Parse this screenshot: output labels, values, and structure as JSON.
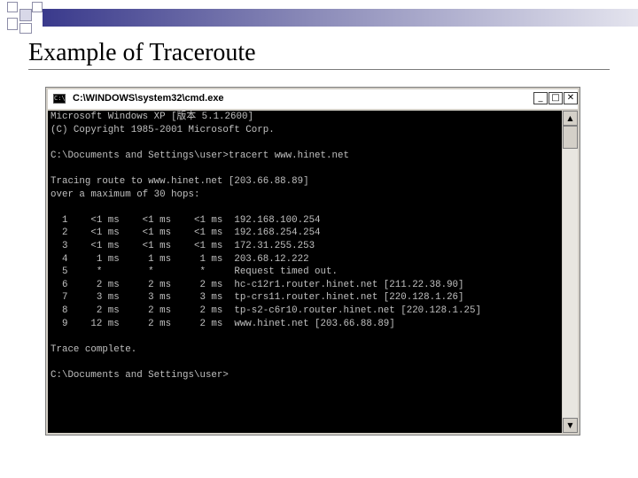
{
  "slide": {
    "title": "Example of Traceroute"
  },
  "window": {
    "title": "C:\\WINDOWS\\system32\\cmd.exe",
    "icon": "cmd-icon",
    "controls": {
      "minimize": "_",
      "maximize": "□",
      "close": "✕"
    }
  },
  "console": {
    "lines": [
      "Microsoft Windows XP [版本 5.1.2600]",
      "(C) Copyright 1985-2001 Microsoft Corp.",
      "",
      "C:\\Documents and Settings\\user>tracert www.hinet.net",
      "",
      "Tracing route to www.hinet.net [203.66.88.89]",
      "over a maximum of 30 hops:",
      "",
      "  1    <1 ms    <1 ms    <1 ms  192.168.100.254",
      "  2    <1 ms    <1 ms    <1 ms  192.168.254.254",
      "  3    <1 ms    <1 ms    <1 ms  172.31.255.253",
      "  4     1 ms     1 ms     1 ms  203.68.12.222",
      "  5     *        *        *     Request timed out.",
      "  6     2 ms     2 ms     2 ms  hc-c12r1.router.hinet.net [211.22.38.90]",
      "  7     3 ms     3 ms     3 ms  tp-crs11.router.hinet.net [220.128.1.26]",
      "  8     2 ms     2 ms     2 ms  tp-s2-c6r10.router.hinet.net [220.128.1.25]",
      "  9    12 ms     2 ms     2 ms  www.hinet.net [203.66.88.89]",
      "",
      "Trace complete.",
      "",
      "C:\\Documents and Settings\\user>"
    ]
  },
  "scrollbar": {
    "up": "▲",
    "down": "▼"
  }
}
